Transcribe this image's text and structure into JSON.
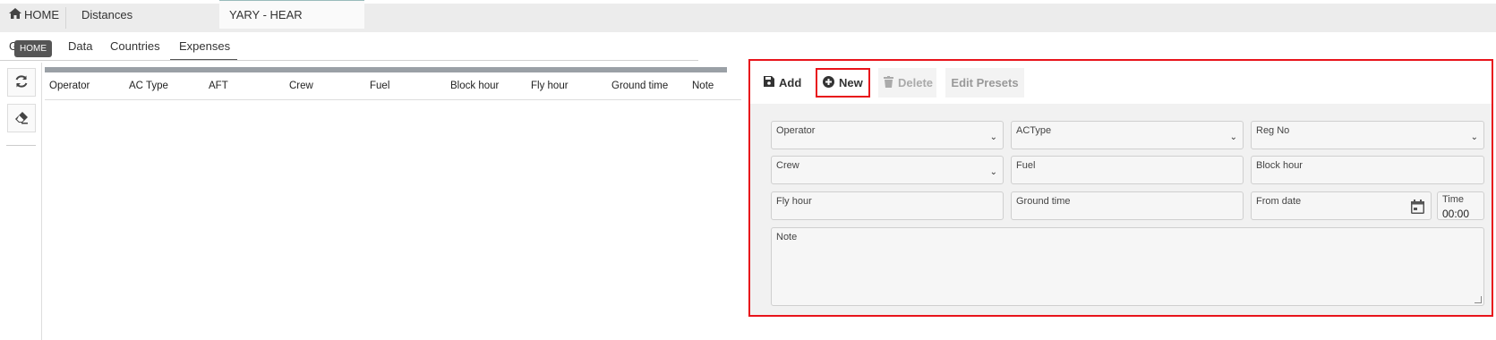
{
  "top_tabs": [
    {
      "label": "HOME",
      "icon": "home-icon"
    },
    {
      "label": "Distances"
    },
    {
      "label": "YARY - HEAR",
      "active": true
    }
  ],
  "sub_tabs": [
    {
      "label": "G"
    },
    {
      "label": "Data"
    },
    {
      "label": "Countries"
    },
    {
      "label": "Expenses",
      "active": true
    }
  ],
  "tooltip": "HOME",
  "grid_columns": [
    "Operator",
    "AC Type",
    "AFT",
    "Crew",
    "Fuel",
    "Block hour",
    "Fly hour",
    "Ground time",
    "Note"
  ],
  "toolbar": {
    "add": "Add",
    "new": "New",
    "delete": "Delete",
    "edit_presets": "Edit Presets"
  },
  "form": {
    "operator": "Operator",
    "actype": "ACType",
    "regno": "Reg No",
    "crew": "Crew",
    "fuel": "Fuel",
    "block_hour": "Block hour",
    "fly_hour": "Fly hour",
    "ground_time": "Ground time",
    "from_date": "From date",
    "time_label": "Time",
    "time_value": "00:00",
    "note": "Note"
  },
  "colors": {
    "highlight": "#e8141b",
    "accent": "#555555"
  }
}
